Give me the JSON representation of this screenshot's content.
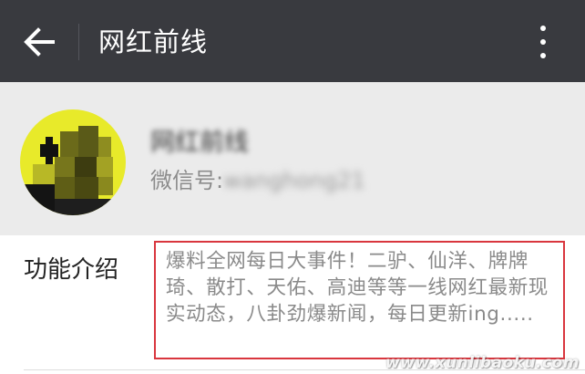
{
  "topbar": {
    "title": "网红前线",
    "back_icon": "arrow-left-icon",
    "more_icon": "more-vertical-icon",
    "background": "#393a3f"
  },
  "profile": {
    "account_name": "网红前线",
    "wechat_id_label": "微信号:",
    "wechat_id_value": "wanghong21",
    "avatar_colors": [
      "#e8ea2a",
      "#111111",
      "#6b6a1a"
    ]
  },
  "intro": {
    "label": "功能介绍",
    "text": "爆料全网每日大事件！二驴、仙洋、牌牌琦、散打、天佑、高迪等等一线网红最新现实动态，八卦劲爆新闻，每日更新ing.....",
    "highlight_color": "#d9363e"
  },
  "watermark": "www.xunlibaoku.com"
}
